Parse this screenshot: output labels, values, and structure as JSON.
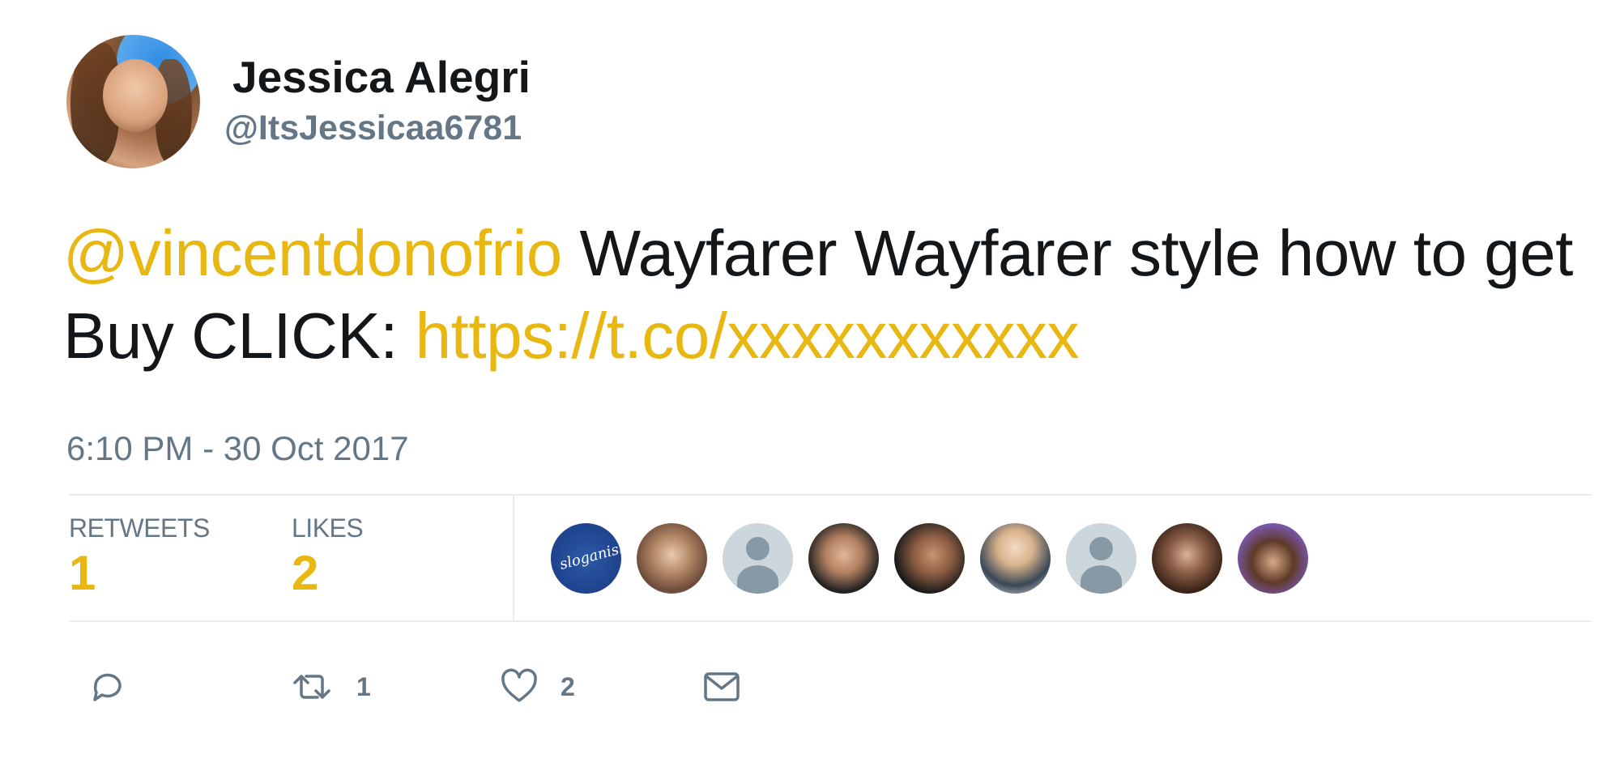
{
  "user": {
    "display_name": "Jessica Alegri",
    "handle": "@ItsJessicaa6781"
  },
  "tweet": {
    "mention": "@vincentdonofrio",
    "text_part1": " Wayfarer Wayfarer style how to get Buy CLICK: ",
    "link": "https://t.co/xxxxxxxxxxx",
    "timestamp": "6:10 PM - 30 Oct 2017"
  },
  "stats": {
    "retweets_label": "RETWEETS",
    "retweets_value": "1",
    "likes_label": "LIKES",
    "likes_value": "2"
  },
  "likers": [
    {
      "kind": "photo",
      "icon": "brand-logo-avatar",
      "text": "sloganish"
    },
    {
      "kind": "photo",
      "icon": "person-avatar"
    },
    {
      "kind": "default",
      "icon": "default-profile-avatar"
    },
    {
      "kind": "photo",
      "icon": "person-avatar"
    },
    {
      "kind": "photo",
      "icon": "person-avatar"
    },
    {
      "kind": "photo",
      "icon": "person-avatar"
    },
    {
      "kind": "default",
      "icon": "default-profile-avatar"
    },
    {
      "kind": "photo",
      "icon": "person-avatar"
    },
    {
      "kind": "photo",
      "icon": "person-avatar"
    }
  ],
  "actions": {
    "retweet_count": "1",
    "like_count": "2"
  },
  "colors": {
    "accent": "#e8b712",
    "muted": "#657786",
    "text": "#14171a",
    "divider": "#e6ecf0"
  }
}
